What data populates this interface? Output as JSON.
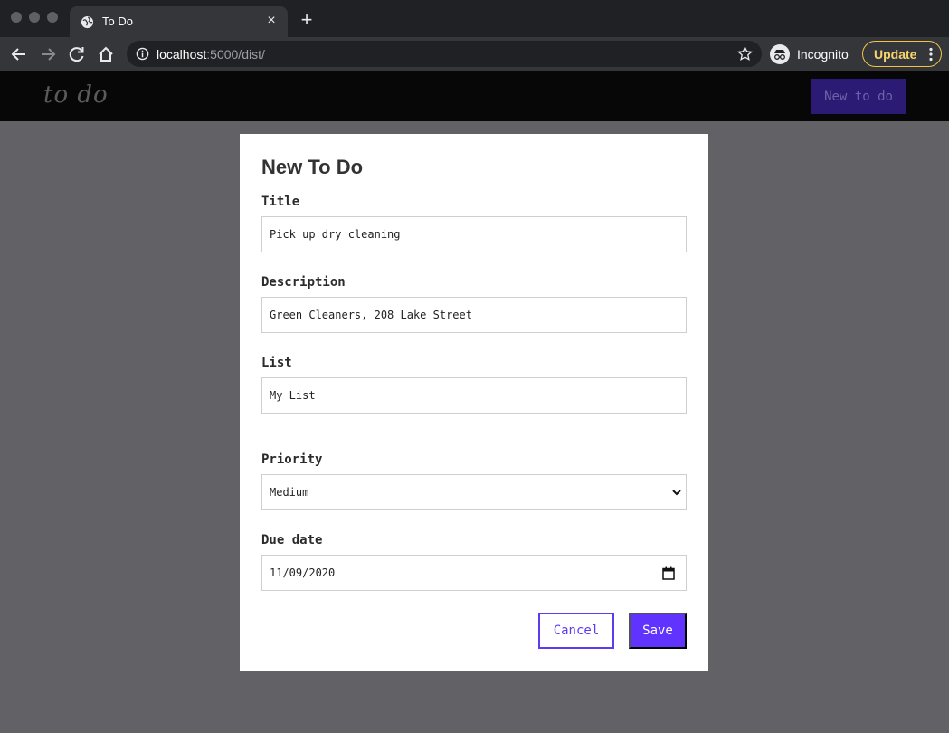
{
  "browser": {
    "tab_title": "To Do",
    "url_host": "localhost",
    "url_path": ":5000/dist/",
    "incognito_label": "Incognito",
    "update_label": "Update",
    "new_tab_symbol": "+",
    "close_symbol": "×"
  },
  "app": {
    "logo_text": "to do",
    "new_todo_label": "New to do"
  },
  "form": {
    "heading": "New To Do",
    "title": {
      "label": "Title",
      "value": "Pick up dry cleaning"
    },
    "description": {
      "label": "Description",
      "value": "Green Cleaners, 208 Lake Street"
    },
    "list": {
      "label": "List",
      "value": "My List"
    },
    "priority": {
      "label": "Priority",
      "value": "Medium"
    },
    "due_date": {
      "label": "Due date",
      "value": "11/09/2020"
    },
    "cancel_label": "Cancel",
    "save_label": "Save"
  },
  "colors": {
    "accent": "#6133ff",
    "header_bg": "#070707",
    "page_bg": "#626266"
  },
  "icons": [
    "globe-icon",
    "close-icon",
    "plus-icon",
    "back-arrow-icon",
    "forward-arrow-icon",
    "reload-icon",
    "home-icon",
    "info-icon",
    "star-icon",
    "incognito-icon",
    "kebab-menu-icon",
    "chevron-down-icon",
    "calendar-icon"
  ]
}
